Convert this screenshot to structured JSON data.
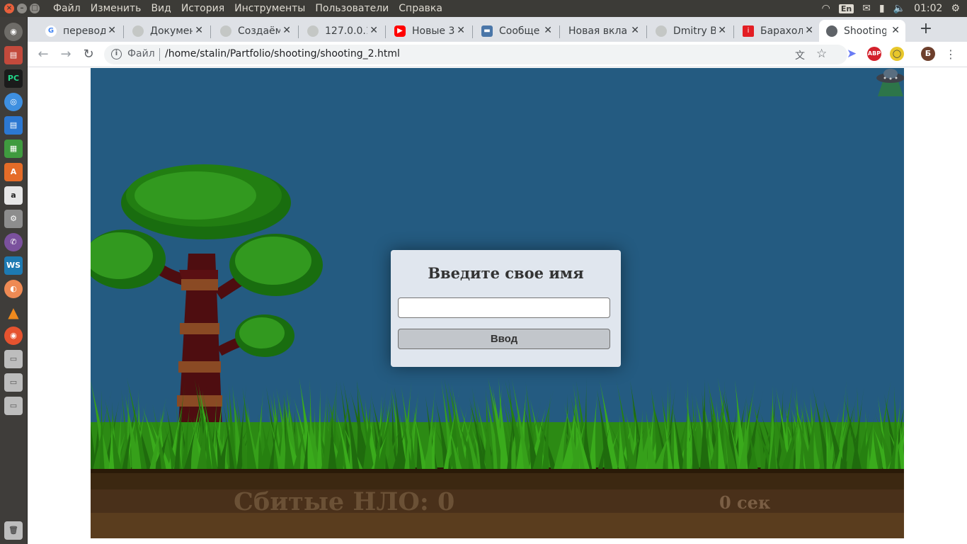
{
  "top_panel": {
    "menu": [
      "Файл",
      "Изменить",
      "Вид",
      "История",
      "Инструменты",
      "Пользователи",
      "Справка"
    ],
    "keyboard_layout": "En",
    "clock": "01:02"
  },
  "tabs": [
    {
      "title": "перевод",
      "icon": "google-icon",
      "color": "#4285f4"
    },
    {
      "title": "Докумен",
      "icon": "globe-icon",
      "color": "#9aa0a6"
    },
    {
      "title": "Создаём",
      "icon": "globe-icon",
      "color": "#9aa0a6"
    },
    {
      "title": "127.0.0.1",
      "icon": "globe-icon",
      "color": "#9aa0a6"
    },
    {
      "title": "Новые 3",
      "icon": "youtube-icon",
      "color": "#ff0000"
    },
    {
      "title": "Сообще",
      "icon": "chat-icon",
      "color": "#4a76a8"
    },
    {
      "title": "Новая вкла",
      "icon": "none",
      "color": ""
    },
    {
      "title": "Dmitry B",
      "icon": "globe-icon",
      "color": "#9aa0a6"
    },
    {
      "title": "Барахол",
      "icon": "avito-icon",
      "color": "#e31e24"
    },
    {
      "title": "Shooting",
      "icon": "globe-icon",
      "color": "#5f6368",
      "active": true
    }
  ],
  "toolbar": {
    "scheme_label": "Файл",
    "url": "/home/stalin/Partfolio/shooting/shooting_2.html",
    "abp_label": "ABP",
    "profile_initial": "Б"
  },
  "game": {
    "score_text": "Сбитые НЛО: 0",
    "timer_text": "0 сек",
    "sky_color": "#245b81"
  },
  "modal": {
    "title": "Введите свое имя",
    "input_value": "",
    "input_placeholder": "",
    "button_label": "Ввод"
  }
}
